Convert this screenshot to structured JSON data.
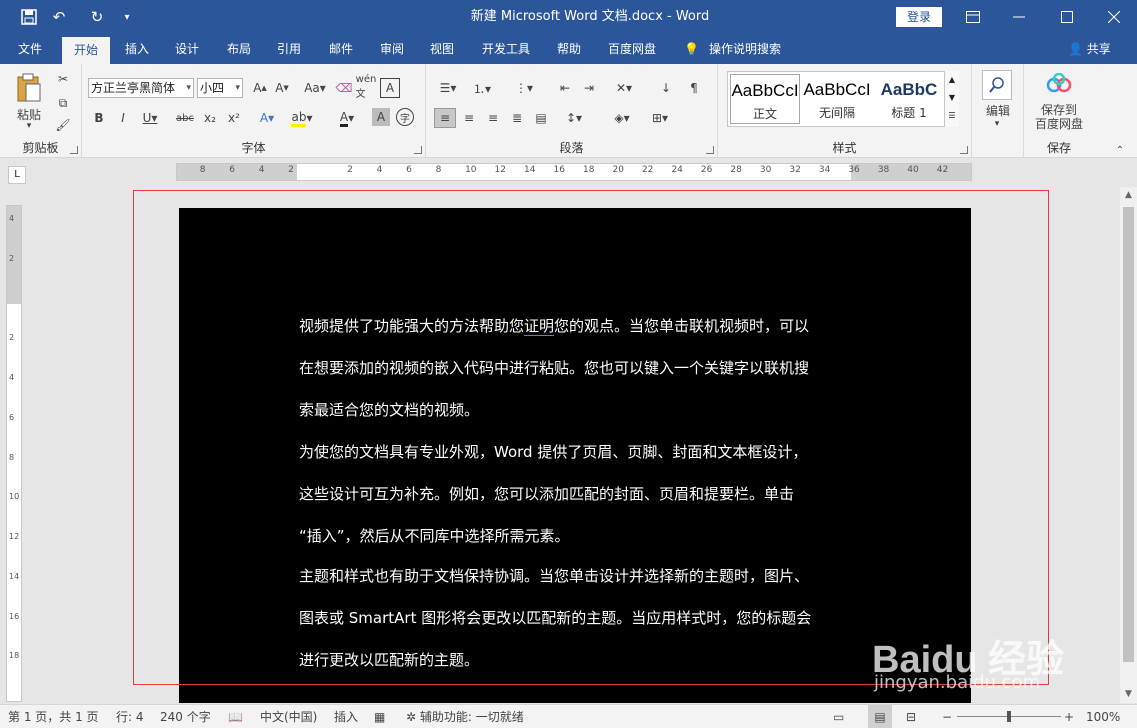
{
  "titlebar": {
    "title": "新建 Microsoft Word 文档.docx  -  Word",
    "login": "登录",
    "quick_access": [
      "save-icon",
      "undo-icon",
      "redo-icon",
      "customize-icon"
    ]
  },
  "tabs": [
    "文件",
    "开始",
    "插入",
    "设计",
    "布局",
    "引用",
    "邮件",
    "审阅",
    "视图",
    "开发工具",
    "帮助",
    "百度网盘"
  ],
  "active_tab": "开始",
  "tell_me": "操作说明搜索",
  "share": "共享",
  "ribbon": {
    "clipboard": {
      "label": "剪贴板",
      "paste": "粘贴"
    },
    "font": {
      "label": "字体",
      "font_name": "方正兰亭黑简体",
      "font_size": "小四"
    },
    "paragraph": {
      "label": "段落"
    },
    "styles": {
      "label": "样式",
      "items": [
        {
          "sample": "AaBbCcI",
          "name": "正文"
        },
        {
          "sample": "AaBbCcI",
          "name": "无间隔"
        },
        {
          "sample": "AaBbC",
          "name": "标题 1"
        }
      ]
    },
    "editing": {
      "label": "编辑"
    },
    "save": {
      "label": "保存",
      "button_line1": "保存到",
      "button_line2": "百度网盘"
    }
  },
  "ruler": {
    "h_numbers": [
      "8",
      "6",
      "4",
      "2",
      "",
      "2",
      "4",
      "6",
      "8",
      "10",
      "12",
      "14",
      "16",
      "18",
      "20",
      "22",
      "24",
      "26",
      "28",
      "30",
      "32",
      "34",
      "36",
      "38",
      "40",
      "42"
    ],
    "v_numbers": [
      "4",
      "2",
      "",
      "2",
      "4",
      "6",
      "8",
      "10",
      "12",
      "14",
      "16",
      "18"
    ]
  },
  "document": {
    "paragraphs": [
      {
        "lines": [
          "视频提供了功能强大的方法帮助您证明您的观点。当您单击联机视频时，可以",
          "在想要添加的视频的嵌入代码中进行粘贴。您也可以键入一个关键字以联机搜",
          "索最适合您的文档的视频。"
        ]
      },
      {
        "lines": [
          "为使您的文档具有专业外观，Word 提供了页眉、页脚、封面和文本框设计，",
          "这些设计可互为补充。例如，您可以添加匹配的封面、页眉和提要栏。单击",
          "“插入”，然后从不同库中选择所需元素。"
        ]
      },
      {
        "lines": [
          "主题和样式也有助于文档保持协调。当您单击设计并选择新的主题时，图片、",
          "图表或 SmartArt 图形将会更改以匹配新的主题。当应用样式时，您的标题会",
          "进行更改以匹配新的主题。"
        ]
      }
    ]
  },
  "watermark": {
    "logo": "Baidu 经验",
    "url": "jingyan.baidu.com"
  },
  "statusbar": {
    "page": "第 1 页，共 1 页",
    "line": "行: 4",
    "words": "240 个字",
    "language": "中文(中国)",
    "mode": "插入",
    "accessibility": "辅助功能: 一切就绪",
    "zoom": "100%"
  },
  "colors": {
    "accent": "#2b579a",
    "page_bg": "#000000",
    "text": "#ffffff",
    "highlight_box": "#e23c3c"
  }
}
